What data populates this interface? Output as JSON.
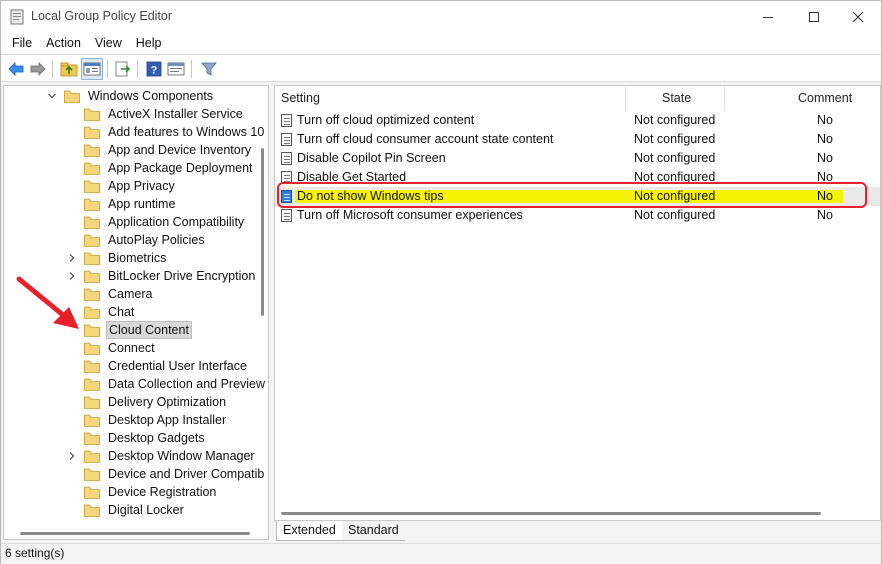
{
  "window": {
    "title": "Local Group Policy Editor",
    "icons": {
      "app": "policy-editor-icon",
      "minimize": "minimize-icon",
      "maximize": "maximize-icon",
      "close": "close-icon"
    }
  },
  "menu": {
    "items": [
      {
        "label": "File"
      },
      {
        "label": "Action"
      },
      {
        "label": "View"
      },
      {
        "label": "Help"
      }
    ]
  },
  "toolbar": {
    "buttons": [
      "back-arrow-icon",
      "forward-arrow-icon",
      "up-folder-icon",
      "show-hide-tree-icon",
      "export-list-icon",
      "help-icon",
      "properties-icon",
      "filter-icon"
    ]
  },
  "tree": {
    "parent": {
      "label": "Windows Components",
      "expanded": true
    },
    "items": [
      {
        "label": "ActiveX Installer Service",
        "expandable": false
      },
      {
        "label": "Add features to Windows 10",
        "expandable": false
      },
      {
        "label": "App and Device Inventory",
        "expandable": false
      },
      {
        "label": "App Package Deployment",
        "expandable": false
      },
      {
        "label": "App Privacy",
        "expandable": false
      },
      {
        "label": "App runtime",
        "expandable": false
      },
      {
        "label": "Application Compatibility",
        "expandable": false
      },
      {
        "label": "AutoPlay Policies",
        "expandable": false
      },
      {
        "label": "Biometrics",
        "expandable": true
      },
      {
        "label": "BitLocker Drive Encryption",
        "expandable": true
      },
      {
        "label": "Camera",
        "expandable": false
      },
      {
        "label": "Chat",
        "expandable": false
      },
      {
        "label": "Cloud Content",
        "expandable": false,
        "selected": true
      },
      {
        "label": "Connect",
        "expandable": false
      },
      {
        "label": "Credential User Interface",
        "expandable": false
      },
      {
        "label": "Data Collection and Preview",
        "expandable": false
      },
      {
        "label": "Delivery Optimization",
        "expandable": false
      },
      {
        "label": "Desktop App Installer",
        "expandable": false
      },
      {
        "label": "Desktop Gadgets",
        "expandable": false
      },
      {
        "label": "Desktop Window Manager",
        "expandable": true
      },
      {
        "label": "Device and Driver Compatib",
        "expandable": false
      },
      {
        "label": "Device Registration",
        "expandable": false
      },
      {
        "label": "Digital Locker",
        "expandable": false
      }
    ]
  },
  "list": {
    "columns": {
      "setting": "Setting",
      "state": "State",
      "comment": "Comment"
    },
    "rows": [
      {
        "setting": "Turn off cloud optimized content",
        "state": "Not configured",
        "comment": "No"
      },
      {
        "setting": "Turn off cloud consumer account state content",
        "state": "Not configured",
        "comment": "No"
      },
      {
        "setting": "Disable Copilot Pin Screen",
        "state": "Not configured",
        "comment": "No"
      },
      {
        "setting": "Disable Get Started",
        "state": "Not configured",
        "comment": "No"
      },
      {
        "setting": "Do not show Windows tips",
        "state": "Not configured",
        "comment": "No",
        "highlighted": true
      },
      {
        "setting": "Turn off Microsoft consumer experiences",
        "state": "Not configured",
        "comment": "No"
      }
    ]
  },
  "tabs": [
    {
      "label": "Extended",
      "active": true
    },
    {
      "label": "Standard",
      "active": false
    }
  ],
  "status": {
    "text": "6 setting(s)"
  },
  "colors": {
    "highlight": "#f5f300",
    "annotation_red": "#e8202a",
    "folder": "#f2c94c"
  }
}
